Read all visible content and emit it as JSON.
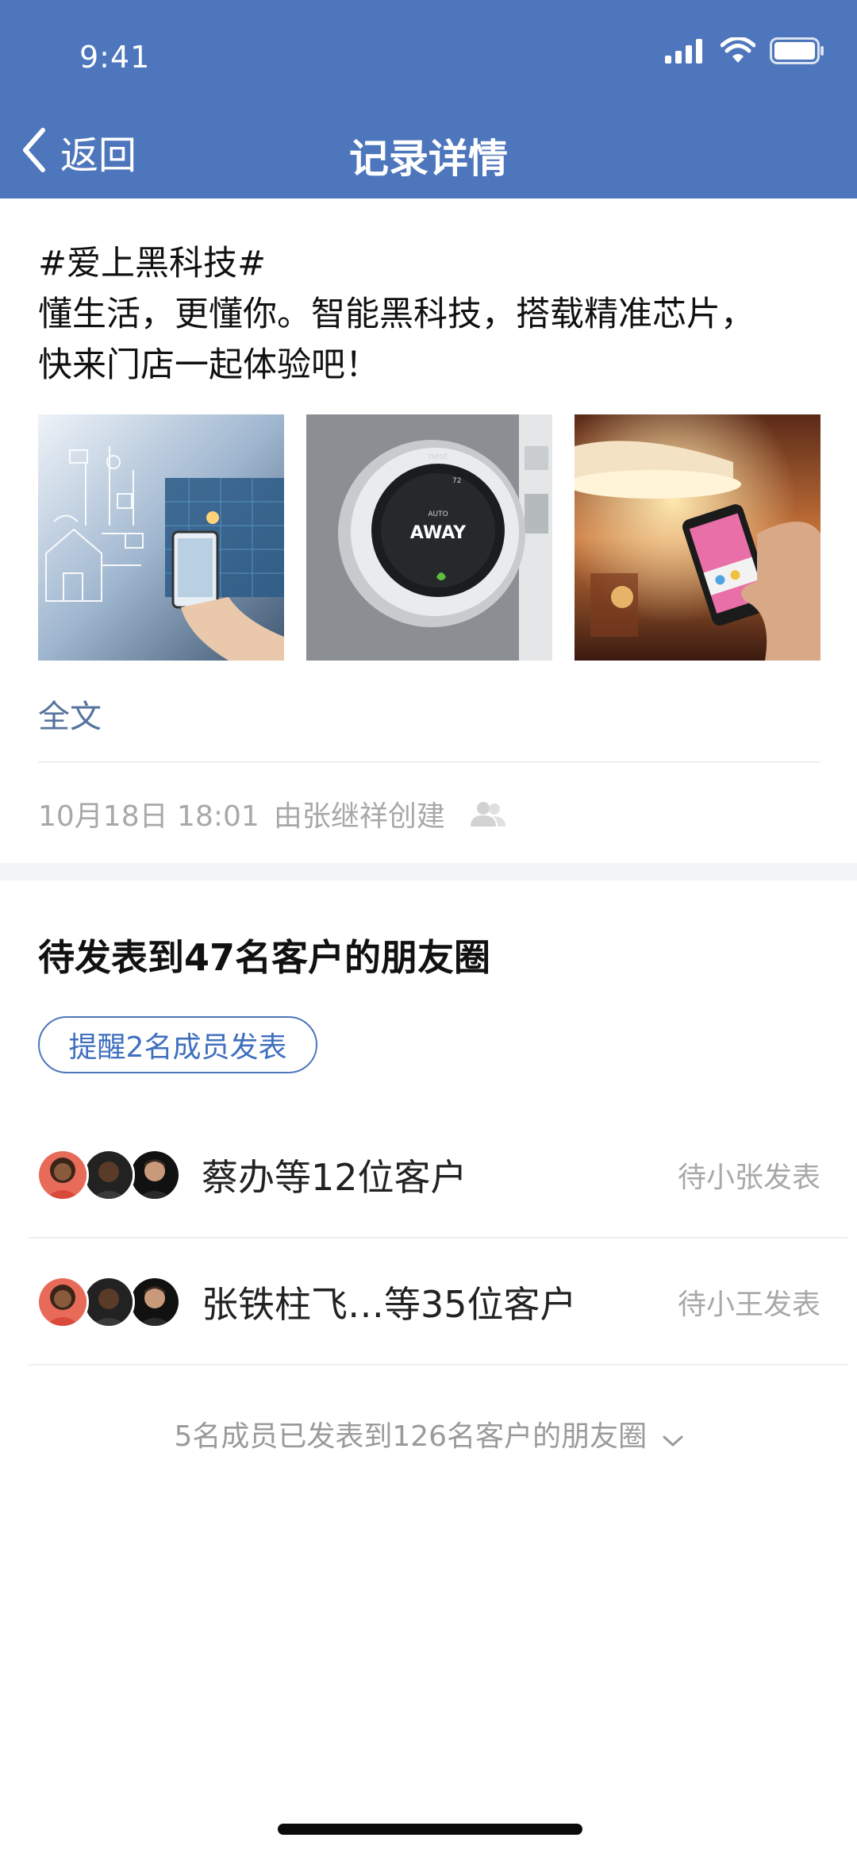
{
  "status_bar": {
    "time": "9:41"
  },
  "nav": {
    "back_label": "返回",
    "title": "记录详情"
  },
  "post": {
    "lines": [
      "#爱上黑科技#",
      "懂生活，更懂你。智能黑科技，搭载精准芯片，",
      "快来门店一起体验吧！"
    ],
    "photos": [
      {
        "name": "smart-home-photo"
      },
      {
        "name": "thermostat-photo",
        "brand": "nest",
        "mode": "AUTO",
        "status": "AWAY",
        "temp": "72"
      },
      {
        "name": "smart-lamp-photo"
      }
    ],
    "fulltext_link": "全文",
    "meta": {
      "time": "10月18日 18:01",
      "creator": "由张继祥创建",
      "icon": "people-icon"
    }
  },
  "pending": {
    "title": "待发表到47名客户的朋友圈",
    "remind_button": "提醒2名成员发表",
    "rows": [
      {
        "label": "蔡办等12位客户",
        "status": "待小张发表"
      },
      {
        "label": "张铁柱飞…等35位客户",
        "status": "待小王发表"
      }
    ],
    "summary": "5名成员已发表到126名客户的朋友圈"
  },
  "colors": {
    "header": "#4e76bc",
    "link": "#56739d",
    "muted": "#a8a8a8"
  }
}
